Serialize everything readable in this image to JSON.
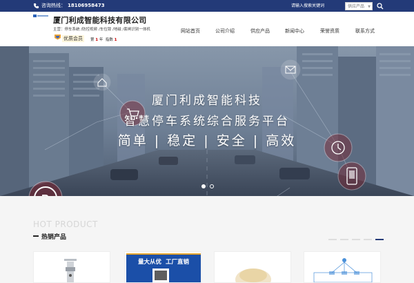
{
  "topbar": {
    "hotline_label": "咨询热线：",
    "hotline_number": "18106958473",
    "search_placeholder": "请输入搜索关键词",
    "search_category": "供应产品",
    "bg_color": "#233a78"
  },
  "header": {
    "company_name": "厦门利成智能科技有限公司",
    "tagline": "主营：停车系统 /防控视频 /车位锁 /地磁 /套闸识别一体机",
    "member_label": "优质会员",
    "years_prefix": "第",
    "years_value": "1",
    "years_unit": "年",
    "index_label": "指数",
    "index_value": "1"
  },
  "nav": {
    "items": [
      {
        "label": "网站首页"
      },
      {
        "label": "公司介绍"
      },
      {
        "label": "供应产品"
      },
      {
        "label": "新闻中心"
      },
      {
        "label": "荣誉资质"
      },
      {
        "label": "联系方式"
      }
    ]
  },
  "banner": {
    "line1": "厦门利成智能科技",
    "line2": "智慧停车系统综合服务平台",
    "line3": "简单 | 稳定 | 安全 | 高效",
    "slides": 2,
    "active_slide": 1
  },
  "hot_section": {
    "title_en": "HOT PRODUCT",
    "title_cn": "热销产品"
  },
  "products": [
    {
      "name": "product-1"
    },
    {
      "name": "product-2",
      "banner_text": "量大从优  工厂直销"
    },
    {
      "name": "product-3"
    },
    {
      "name": "product-4"
    }
  ]
}
